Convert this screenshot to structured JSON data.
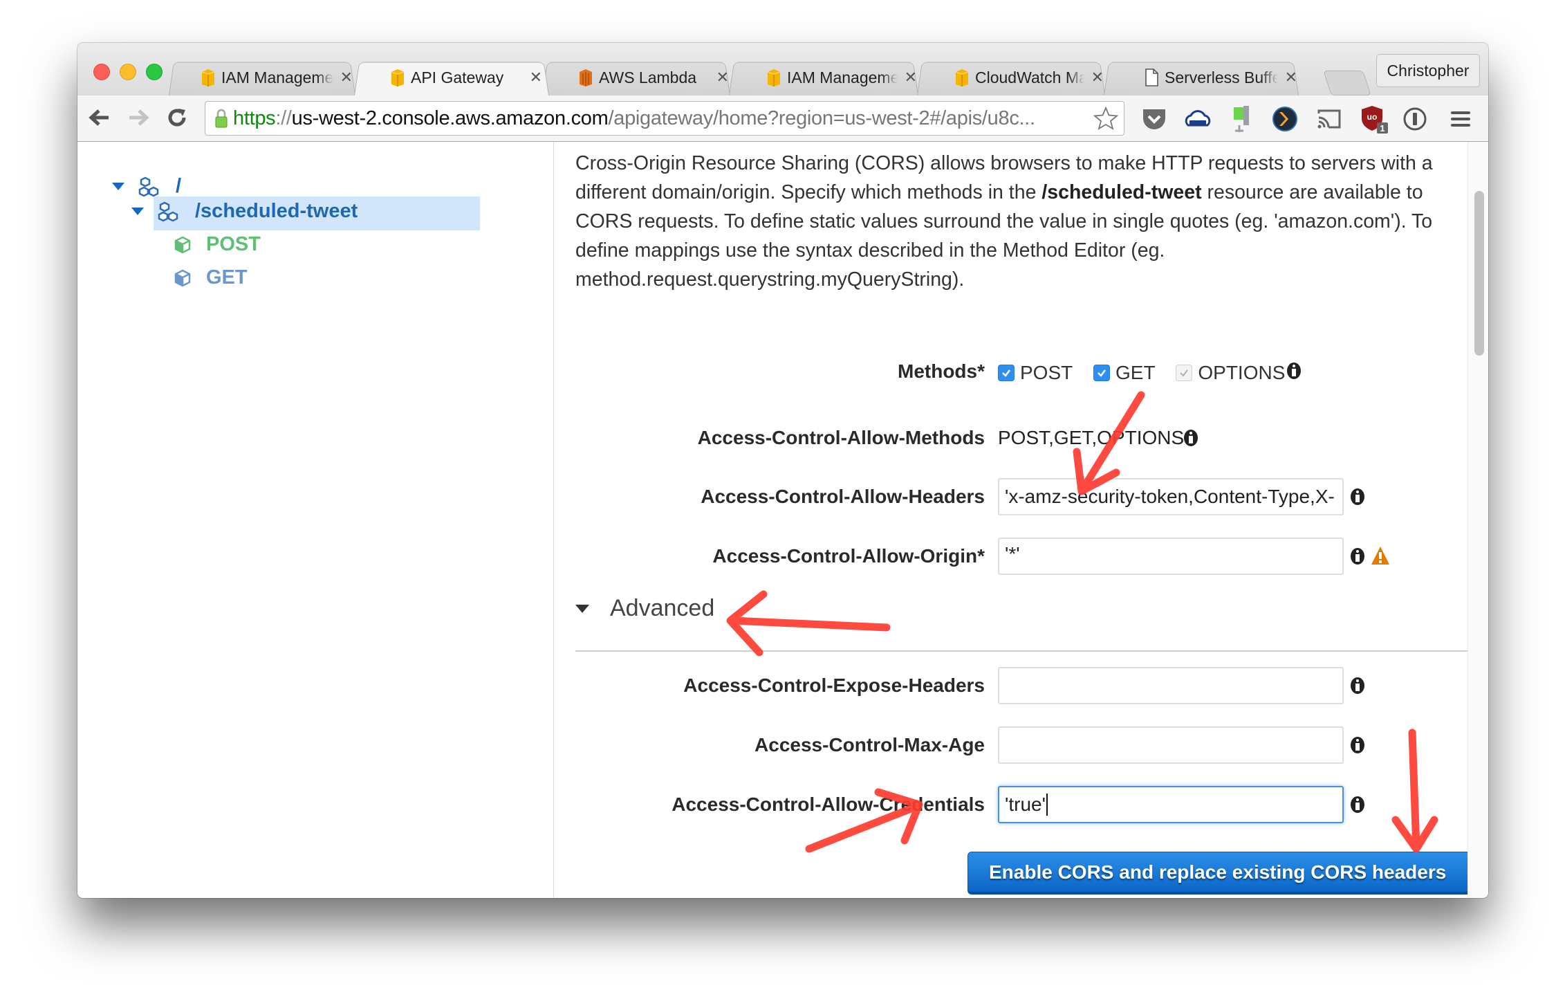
{
  "browser": {
    "tabs": [
      {
        "label": "IAM Management Console",
        "favicon": "aws-cube-icon",
        "active": false
      },
      {
        "label": "API Gateway",
        "favicon": "aws-cube-icon",
        "active": true
      },
      {
        "label": "AWS Lambda",
        "favicon": "aws-lambda-icon",
        "active": false
      },
      {
        "label": "IAM Management Console",
        "favicon": "aws-cube-icon",
        "active": false
      },
      {
        "label": "CloudWatch Management Console",
        "favicon": "aws-cube-icon",
        "active": false
      },
      {
        "label": "Serverless Buffer",
        "favicon": "document-icon",
        "active": false
      }
    ],
    "close_glyph": "✕",
    "profile_name": "Christopher",
    "url": {
      "scheme": "https",
      "separator": "://",
      "host": "us-west-2.console.aws.amazon.com",
      "path": "/apigateway/home?region=us-west-2#/apis/u8c..."
    },
    "extensions": [
      "pocket-icon",
      "cloud-printer-icon",
      "vise-clamp-icon",
      "plex-icon",
      "cast-icon",
      "ublock-icon",
      "1password-icon",
      "menu-icon"
    ],
    "ublock_badge": "1"
  },
  "sidebar": {
    "tree": [
      {
        "label": "/",
        "type": "resource",
        "expanded": true,
        "level": 0
      },
      {
        "label": "/scheduled-tweet",
        "type": "resource",
        "expanded": true,
        "level": 1,
        "selected": true
      },
      {
        "label": "POST",
        "type": "method",
        "level": 2,
        "color": "#5fbf74"
      },
      {
        "label": "GET",
        "type": "method",
        "level": 2,
        "color": "#6a96cc"
      }
    ]
  },
  "main": {
    "description_1": "Cross-Origin Resource Sharing (CORS) allows browsers to make HTTP requests to servers with a different domain/origin. Specify which methods in the ",
    "description_bold": "/scheduled-tweet",
    "description_2": " resource are available to CORS requests. To define static values surround the value in single quotes (eg. 'amazon.com'). To define mappings use the syntax described in the Method Editor (eg. method.request.querystring.myQueryString).",
    "methods_label": "Methods*",
    "methods": [
      {
        "label": "POST",
        "checked": true,
        "disabled": false
      },
      {
        "label": "GET",
        "checked": true,
        "disabled": false
      },
      {
        "label": "OPTIONS",
        "checked": true,
        "disabled": true
      }
    ],
    "allow_methods_label": "Access-Control-Allow-Methods",
    "allow_methods_value": "POST,GET,OPTIONS",
    "allow_headers_label": "Access-Control-Allow-Headers",
    "allow_headers_value": "'x-amz-security-token,Content-Type,X-",
    "allow_origin_label": "Access-Control-Allow-Origin*",
    "allow_origin_value": "'*'",
    "advanced_label": "Advanced",
    "expose_headers_label": "Access-Control-Expose-Headers",
    "expose_headers_value": "",
    "max_age_label": "Access-Control-Max-Age",
    "max_age_value": "",
    "allow_credentials_label": "Access-Control-Allow-Credentials",
    "allow_credentials_value": "'true'",
    "enable_button": "Enable CORS and replace existing CORS headers"
  },
  "colors": {
    "accent_blue": "#1467c2",
    "button_blue": "#1a7ad9",
    "warning_orange": "#e07b00",
    "annotation_red": "#ff3b30",
    "selection_bg": "#d1e6fb"
  }
}
